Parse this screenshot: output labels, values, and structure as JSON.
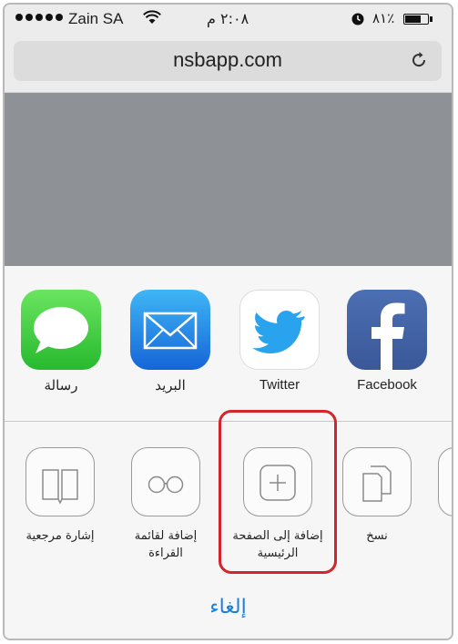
{
  "status_bar": {
    "carrier": "Zain SA",
    "time": "٢:٠٨ م",
    "battery_percent": "٨١٪"
  },
  "address_bar": {
    "url": "nsbapp.com"
  },
  "share_apps": [
    {
      "label": "رسالة",
      "icon": "messages-icon"
    },
    {
      "label": "البريد",
      "icon": "mail-icon"
    },
    {
      "label": "Twitter",
      "icon": "twitter-icon"
    },
    {
      "label": "Facebook",
      "icon": "facebook-icon"
    }
  ],
  "actions": [
    {
      "label": "إشارة مرجعية",
      "icon": "bookmark-icon"
    },
    {
      "label": "إضافة لقائمة القراءة",
      "icon": "reading-list-icon"
    },
    {
      "label": "إضافة إلى الصفحة الرئيسية",
      "icon": "add-home-icon"
    },
    {
      "label": "نسخ",
      "icon": "copy-icon"
    }
  ],
  "cancel_label": "إلغاء",
  "colors": {
    "highlight": "#d4242c",
    "cancel": "#1a7de0",
    "page_bg": "#8e9196"
  }
}
